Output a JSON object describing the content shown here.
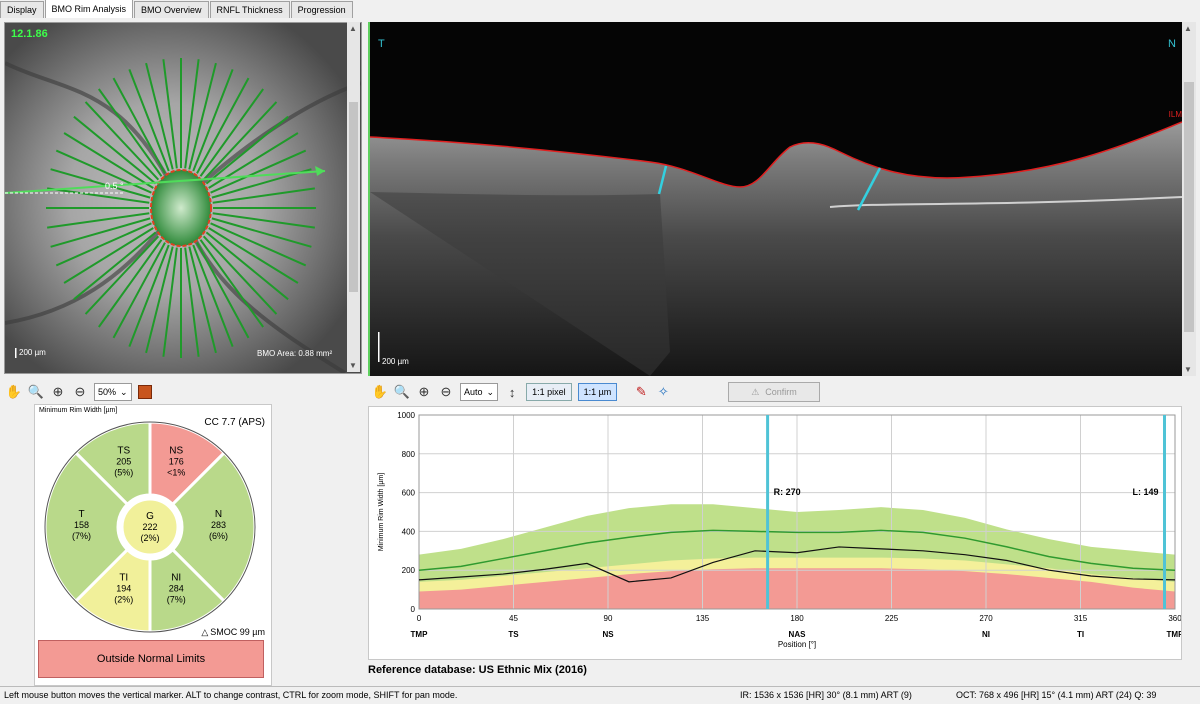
{
  "tabs": [
    "Display",
    "BMO Rim Analysis",
    "BMO Overview",
    "RNFL Thickness",
    "Progression"
  ],
  "active_tab": 1,
  "fundus": {
    "badge": "12.1.86",
    "scale": "200 µm",
    "bmo_area": "BMO Area: 0.88 mm²",
    "angle_label": "0.5 °"
  },
  "bscan": {
    "left_label": "T",
    "right_label": "N",
    "ilm_label": "ILM",
    "scale": "200 µm"
  },
  "left_toolbar": {
    "zoom_value": "50%"
  },
  "right_toolbar": {
    "auto_value": "Auto",
    "pixel_button": "1:1 pixel",
    "um_button": "1:1 µm",
    "confirm_button": "Confirm"
  },
  "wheel": {
    "title": "Minimum Rim Width [µm]",
    "cc": "CC 7.7 (APS)",
    "smoc": "SMOC 99 µm",
    "sectors": [
      {
        "code": "TS",
        "value": "205",
        "pct": "(5%)",
        "color": "#b9d98a"
      },
      {
        "code": "NS",
        "value": "176",
        "pct": "<1%",
        "color": "#f39a94"
      },
      {
        "code": "N",
        "value": "283",
        "pct": "(6%)",
        "color": "#b9d98a"
      },
      {
        "code": "NI",
        "value": "284",
        "pct": "(7%)",
        "color": "#b9d98a"
      },
      {
        "code": "TI",
        "value": "194",
        "pct": "(2%)",
        "color": "#f1f09a"
      },
      {
        "code": "T",
        "value": "158",
        "pct": "(7%)",
        "color": "#b9d98a"
      },
      {
        "code": "G",
        "value": "222",
        "pct": "(2%)",
        "color": "#f1f09a"
      }
    ],
    "classification": "Outside Normal Limits"
  },
  "chart_data": {
    "type": "area",
    "ylabel": "Minimum Rim Width [µm]",
    "xlabel": "Position [°]",
    "xlim": [
      0,
      360
    ],
    "ylim": [
      0,
      1000
    ],
    "yticks": [
      0,
      200,
      400,
      600,
      800,
      1000
    ],
    "xticks": [
      0,
      45,
      90,
      135,
      180,
      225,
      270,
      315,
      360
    ],
    "sector_labels": [
      {
        "x": 0,
        "label": "TMP"
      },
      {
        "x": 45,
        "label": "TS"
      },
      {
        "x": 90,
        "label": "NS"
      },
      {
        "x": 180,
        "label": "NAS"
      },
      {
        "x": 270,
        "label": "NI"
      },
      {
        "x": 315,
        "label": "TI"
      },
      {
        "x": 360,
        "label": "TMP"
      }
    ],
    "markers": [
      {
        "x": 166,
        "label": "R: 270"
      },
      {
        "x": 355,
        "label": "L: 149"
      }
    ],
    "x": [
      0,
      20,
      40,
      60,
      80,
      100,
      120,
      140,
      160,
      180,
      200,
      220,
      240,
      260,
      280,
      300,
      320,
      340,
      360
    ],
    "band_red": [
      90,
      100,
      120,
      140,
      160,
      180,
      195,
      205,
      210,
      210,
      210,
      210,
      205,
      195,
      180,
      160,
      140,
      110,
      90
    ],
    "band_yellow": [
      140,
      150,
      170,
      190,
      210,
      230,
      250,
      260,
      265,
      265,
      265,
      265,
      260,
      250,
      230,
      210,
      180,
      160,
      140
    ],
    "band_green": [
      280,
      310,
      360,
      420,
      480,
      520,
      540,
      540,
      520,
      500,
      510,
      525,
      510,
      470,
      410,
      360,
      320,
      300,
      280
    ],
    "normal_mean": [
      200,
      220,
      260,
      300,
      340,
      370,
      395,
      405,
      400,
      395,
      395,
      405,
      395,
      365,
      320,
      270,
      235,
      210,
      200
    ],
    "measured": [
      150,
      165,
      180,
      205,
      235,
      140,
      160,
      240,
      300,
      290,
      320,
      310,
      300,
      280,
      250,
      200,
      170,
      155,
      150
    ]
  },
  "reference_db": "Reference database: US Ethnic Mix (2016)",
  "status": {
    "hint": "Left mouse button moves the vertical marker. ALT to change contrast, CTRL for zoom mode, SHIFT for pan mode.",
    "ir": "IR: 1536 x 1536 [HR] 30° (8.1 mm) ART (9)",
    "oct": "OCT: 768 x 496 [HR] 15° (4.1 mm) ART (24) Q: 39"
  }
}
